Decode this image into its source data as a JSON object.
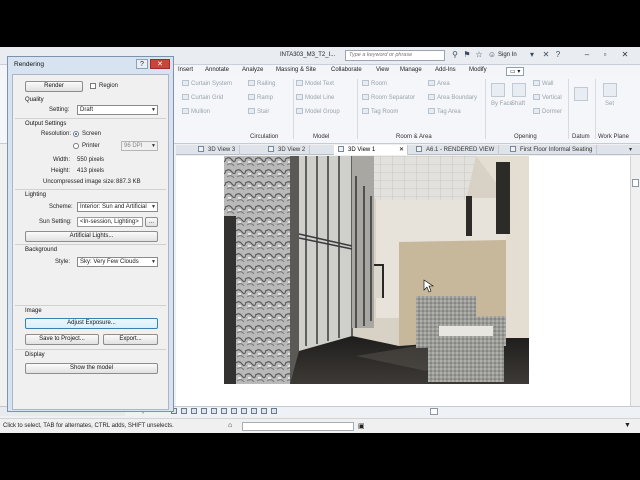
{
  "window": {
    "doc_title": "INTA303_M3_T2_I...",
    "search_placeholder": "Type a keyword or phrase",
    "sign_in": "Sign In"
  },
  "ribbon_tabs": [
    "Insert",
    "Annotate",
    "Analyze",
    "Massing & Site",
    "Collaborate",
    "View",
    "Manage",
    "Add-Ins",
    "Modify"
  ],
  "ribbon": {
    "circulation": {
      "panel": "Circulation",
      "items": [
        "Curtain System",
        "Curtain Grid",
        "Mullion",
        "Railing",
        "Ramp",
        "Stair"
      ]
    },
    "model": {
      "panel": "Model",
      "items": [
        "Model Text",
        "Model Line",
        "Model Group"
      ]
    },
    "room_area": {
      "panel": "Room & Area",
      "items": [
        "Room",
        "Room Separator",
        "Tag Room",
        "Area",
        "Area Boundary",
        "Tag Area"
      ]
    },
    "opening": {
      "panel": "Opening",
      "items": [
        "By Face",
        "Shaft",
        "Wall",
        "Vertical",
        "Dormer"
      ]
    },
    "datum": {
      "panel": "Datum"
    },
    "work_plane": {
      "panel": "Work Plane",
      "set": "Set"
    }
  },
  "view_tabs": [
    "3D View 3",
    "3D View 2",
    "3D View 1",
    "A6.1 - RENDERED VIEW",
    "First Floor Informal Seating"
  ],
  "active_view_tab": "3D View 1",
  "view_control": {
    "scale": "Perspective"
  },
  "status_bar": {
    "text": "Click to select, TAB for alternates, CTRL adds, SHIFT unselects."
  },
  "dialog": {
    "title": "Rendering",
    "render_button": "Render",
    "region_label": "Region",
    "quality": {
      "section": "Quality",
      "setting_label": "Setting:",
      "setting_value": "Draft"
    },
    "output": {
      "section": "Output Settings",
      "resolution_label": "Resolution:",
      "screen_label": "Screen",
      "printer_label": "Printer",
      "dpi_value": "96 DPI",
      "width_label": "Width:",
      "width_value": "550 pixels",
      "height_label": "Height:",
      "height_value": "413 pixels",
      "size_label": "Uncompressed image size:",
      "size_value": "887.3 KB"
    },
    "lighting": {
      "section": "Lighting",
      "scheme_label": "Scheme:",
      "scheme_value": "Interior: Sun and Artificial",
      "sun_label": "Sun Setting:",
      "sun_value": "<In-session, Lighting>",
      "sun_more": "...",
      "artificial_button": "Artificial Lights..."
    },
    "background": {
      "section": "Background",
      "style_label": "Style:",
      "style_value": "Sky: Very Few Clouds"
    },
    "image": {
      "section": "Image",
      "adjust_button": "Adjust Exposure...",
      "save_button": "Save to Project...",
      "export_button": "Export..."
    },
    "display": {
      "section": "Display",
      "show_button": "Show the model"
    }
  }
}
